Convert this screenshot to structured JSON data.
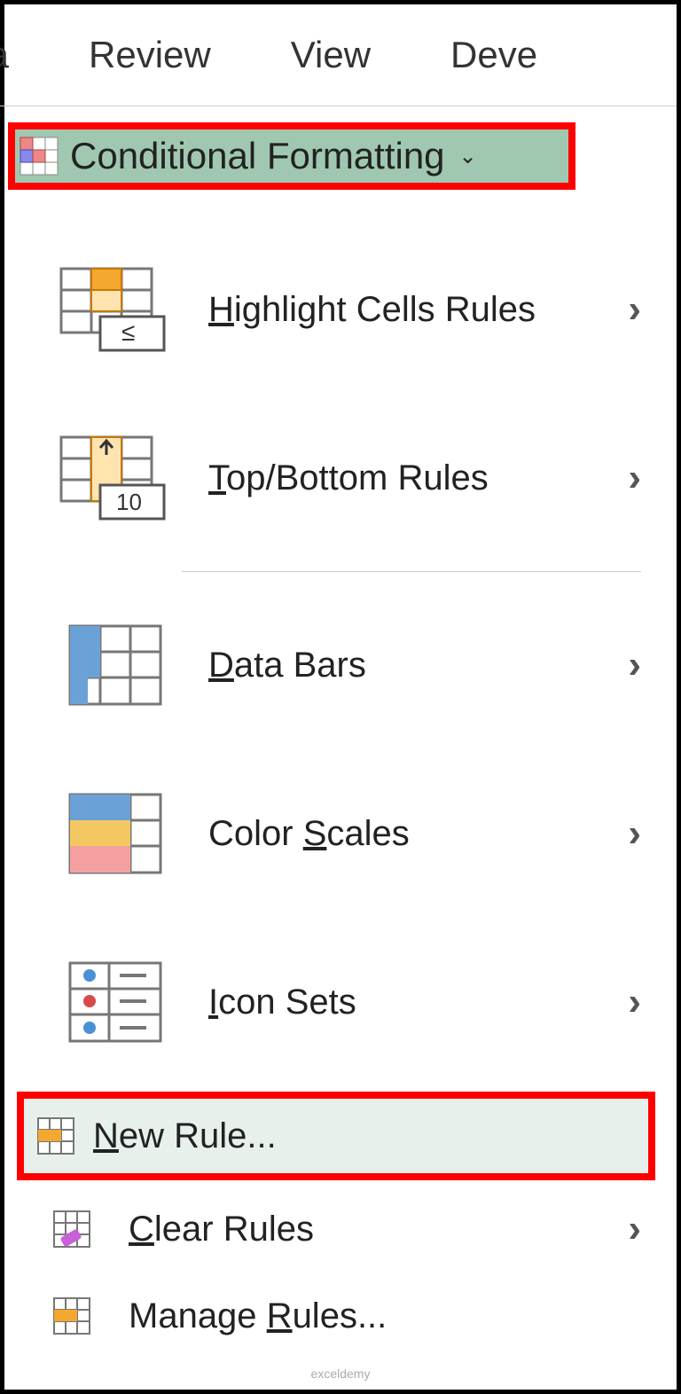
{
  "ribbon": {
    "tabs": [
      "ta",
      "Review",
      "View",
      "Deve"
    ]
  },
  "cf_button": {
    "label": "Conditional Formatting"
  },
  "menu": {
    "highlight_cells": {
      "prefix": "H",
      "rest": "ighlight Cells Rules"
    },
    "top_bottom": {
      "prefix": "T",
      "rest": "op/Bottom Rules"
    },
    "data_bars": {
      "prefix": "D",
      "rest": "ata Bars"
    },
    "color_scales": {
      "before": "Color ",
      "prefix": "S",
      "rest": "cales"
    },
    "icon_sets": {
      "prefix": "I",
      "rest": "con Sets"
    },
    "new_rule": {
      "prefix": "N",
      "rest": "ew Rule..."
    },
    "clear_rules": {
      "prefix": "C",
      "rest": "lear Rules"
    },
    "manage_rules": {
      "before": "Manage ",
      "prefix": "R",
      "rest": "ules..."
    }
  },
  "watermark": "exceldemy"
}
